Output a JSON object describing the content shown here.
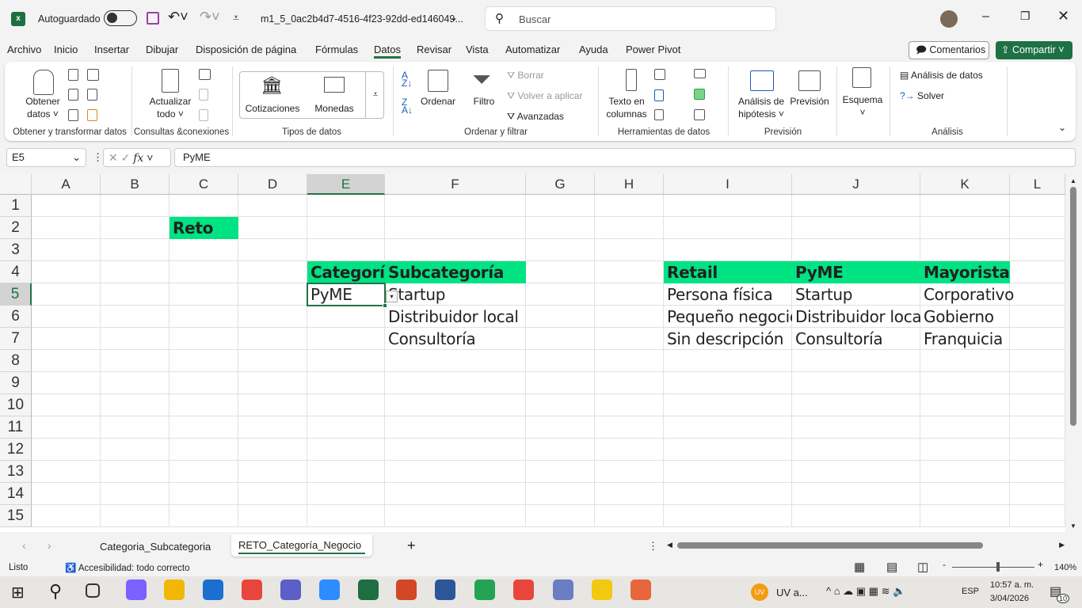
{
  "titlebar": {
    "autosave": "Autoguardado",
    "filename": "m1_5_0ac2b4d7-4516-4f23-92dd-ed146049...",
    "search_placeholder": "Buscar"
  },
  "menu": [
    "Archivo",
    "Inicio",
    "Insertar",
    "Dibujar",
    "Disposición de página",
    "Fórmulas",
    "Datos",
    "Revisar",
    "Vista",
    "Automatizar",
    "Ayuda",
    "Power Pivot"
  ],
  "actions": {
    "comments": "Comentarios",
    "share": "Compartir"
  },
  "ribbon": {
    "get_data": "Obtener",
    "get_data2": "datos",
    "group1": "Obtener y transformar datos",
    "refresh": "Actualizar",
    "refresh2": "todo",
    "group2": "Consultas &conexiones",
    "stocks": "Cotizaciones",
    "currencies": "Monedas",
    "group3": "Tipos de datos",
    "sort": "Ordenar",
    "filter": "Filtro",
    "clear": "Borrar",
    "reapply": "Volver a aplicar",
    "advanced": "Avanzadas",
    "group4": "Ordenar y filtrar",
    "text_cols": "Texto en",
    "text_cols2": "columnas",
    "group5": "Herramientas de datos",
    "whatif": "Análisis de",
    "whatif2": "hipótesis",
    "forecast": "Previsión",
    "group6": "Previsión",
    "outline": "Esquema",
    "data_analysis": "Análisis de datos",
    "solver": "Solver",
    "group7": "Análisis"
  },
  "formula_bar": {
    "name_box": "E5",
    "fx": "fx",
    "value": "PyME"
  },
  "columns": [
    "A",
    "B",
    "C",
    "D",
    "E",
    "F",
    "G",
    "H",
    "I",
    "J",
    "K",
    "L"
  ],
  "rows": [
    "1",
    "2",
    "3",
    "4",
    "5",
    "6",
    "7",
    "8",
    "9",
    "10",
    "11",
    "12",
    "13",
    "14",
    "15"
  ],
  "cells": [
    {
      "ref": "C2",
      "text": "Reto",
      "bold": true,
      "fill": true
    },
    {
      "ref": "E4",
      "text": "Categoría",
      "bold": true,
      "fill": true
    },
    {
      "ref": "F4",
      "text": "Subcategoría",
      "bold": true,
      "fill": true
    },
    {
      "ref": "E5",
      "text": "PyME"
    },
    {
      "ref": "F5",
      "text": "Startup"
    },
    {
      "ref": "F6",
      "text": "Distribuidor local"
    },
    {
      "ref": "F7",
      "text": "Consultoría"
    },
    {
      "ref": "I4",
      "text": "Retail",
      "bold": true,
      "fill": true
    },
    {
      "ref": "J4",
      "text": "PyME",
      "bold": true,
      "fill": true
    },
    {
      "ref": "K4",
      "text": "Mayorista",
      "bold": true,
      "fill": true
    },
    {
      "ref": "I5",
      "text": "Persona física"
    },
    {
      "ref": "I6",
      "text": "Pequeño negocio"
    },
    {
      "ref": "I7",
      "text": "Sin descripción"
    },
    {
      "ref": "J5",
      "text": "Startup"
    },
    {
      "ref": "J6",
      "text": "Distribuidor local"
    },
    {
      "ref": "J7",
      "text": "Consultoría"
    },
    {
      "ref": "K5",
      "text": "Corporativo"
    },
    {
      "ref": "K6",
      "text": "Gobierno"
    },
    {
      "ref": "K7",
      "text": "Franquicia"
    }
  ],
  "sheets": [
    "Categoria_Subcategoria",
    "RETO_Categoría_Negocio"
  ],
  "status": {
    "ready": "Listo",
    "accessibility": "Accesibilidad: todo correcto",
    "zoom": "140%"
  },
  "taskbar": {
    "uv": "UV a...",
    "lang": "ESP",
    "time": "10:57 a. m.",
    "date": "3/04/2026",
    "notif": "10"
  },
  "colors": {
    "accent": "#217346",
    "fill": "#00e383",
    "share": "#1e7145"
  }
}
